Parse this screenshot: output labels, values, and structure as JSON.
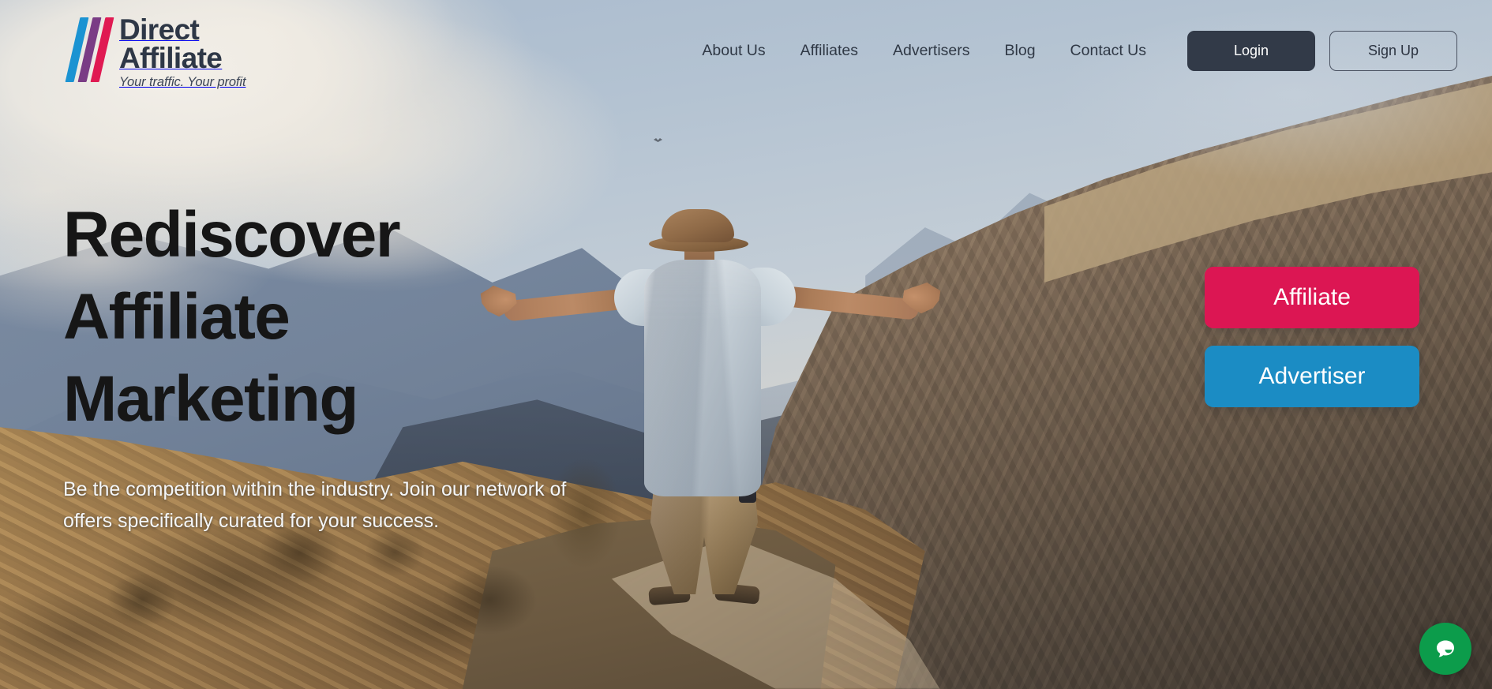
{
  "brand": {
    "line1": "Direct",
    "line2": "Affiliate",
    "tagline": "Your traffic. Your profit",
    "bar_colors": [
      "#1b93d2",
      "#7a3c85",
      "#e01a52"
    ],
    "wordmark_color": "#2e3746"
  },
  "nav": {
    "items": [
      {
        "label": "About Us"
      },
      {
        "label": "Affiliates"
      },
      {
        "label": "Advertisers"
      },
      {
        "label": "Blog"
      },
      {
        "label": "Contact Us"
      }
    ],
    "login_label": "Login",
    "signup_label": "Sign Up",
    "login_bg": "#323a48",
    "login_text": "#ffffff",
    "signup_border": "#4a5261",
    "signup_text": "#2b3340"
  },
  "hero": {
    "title_lines": [
      "Rediscover",
      "Affiliate",
      "Marketing"
    ],
    "title_color": "#161616",
    "subtext": "Be the competition within the industry. Join our network of offers specifically curated for your success.",
    "subtext_color": "#f4f6f8"
  },
  "cta": {
    "buttons": [
      {
        "label": "Affiliate",
        "color": "#dc1653",
        "name": "affiliate-cta-button"
      },
      {
        "label": "Advertiser",
        "color": "#1b8cc4",
        "name": "advertiser-cta-button"
      }
    ]
  },
  "chat_widget": {
    "icon": "chat-bubble-icon",
    "color": "#0c9c4b",
    "bubble_color": "#ffffff"
  },
  "background": {
    "type": "photograph",
    "description": "Man in white shirt and bucket hat standing on a mountain cliff edge with arms outstretched, facing a hazy valley and sunlit rocky ridges",
    "sky_color": "#b4c3d2",
    "cliff_color": "#8a7458",
    "foreground_color": "#b8945e"
  }
}
